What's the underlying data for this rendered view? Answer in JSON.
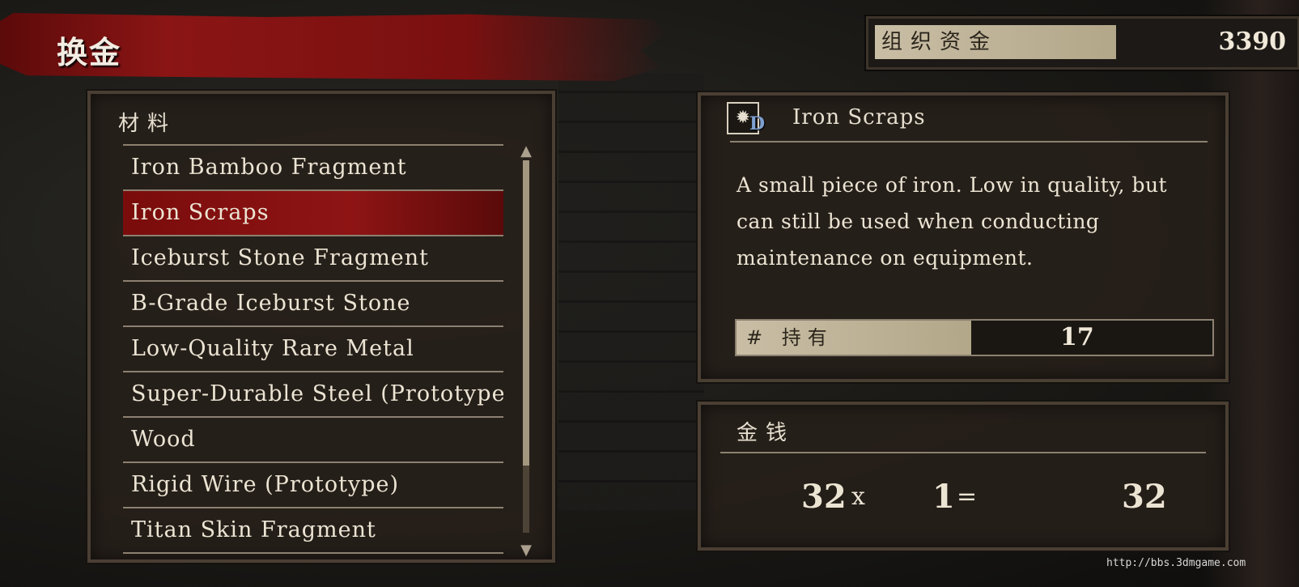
{
  "title": "换金",
  "funds": {
    "label": "组织资金",
    "value": "3390"
  },
  "materials": {
    "header": "材料",
    "items": [
      {
        "label": "Iron Bamboo Fragment",
        "selected": false
      },
      {
        "label": "Iron Scraps",
        "selected": true
      },
      {
        "label": "Iceburst Stone Fragment",
        "selected": false
      },
      {
        "label": "B-Grade Iceburst Stone",
        "selected": false
      },
      {
        "label": "Low-Quality Rare Metal",
        "selected": false
      },
      {
        "label": "Super-Durable Steel (Prototype)",
        "selected": false
      },
      {
        "label": "Wood",
        "selected": false
      },
      {
        "label": "Rigid Wire (Prototype)",
        "selected": false
      },
      {
        "label": "Titan Skin Fragment",
        "selected": false
      }
    ],
    "scroll_fraction": 0.82
  },
  "detail": {
    "icon": "gear-cluster-icon",
    "grade": "D",
    "name": "Iron Scraps",
    "description": "A small piece of iron. Low in quality, but can still be used when conducting maintenance on equipment.",
    "owned_label": "# 持有",
    "owned_value": "17"
  },
  "money": {
    "header": "金钱",
    "unit_price": "32",
    "times": "x",
    "quantity": "1",
    "equals": "=",
    "total": "32"
  },
  "watermark": "http://bbs.3dmgame.com"
}
